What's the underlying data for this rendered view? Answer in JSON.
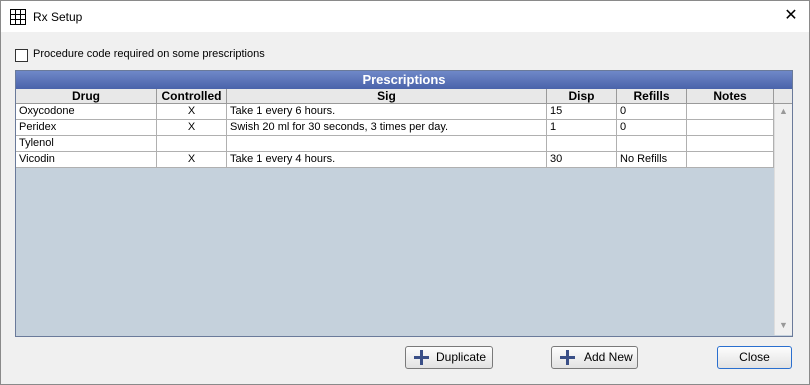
{
  "window": {
    "title": "Rx Setup",
    "close_glyph": "✕"
  },
  "options": {
    "procedure_code_label": "Procedure code required on some prescriptions",
    "procedure_code_checked": false
  },
  "grid": {
    "title": "Prescriptions",
    "columns": [
      "Drug",
      "Controlled",
      "Sig",
      "Disp",
      "Refills",
      "Notes"
    ],
    "rows": [
      {
        "drug": "Oxycodone",
        "controlled": "X",
        "sig": "Take 1 every 6 hours.",
        "disp": "15",
        "refills": "0",
        "notes": ""
      },
      {
        "drug": "Peridex",
        "controlled": "X",
        "sig": "Swish 20 ml for 30 seconds, 3 times per day.",
        "disp": "1",
        "refills": "0",
        "notes": ""
      },
      {
        "drug": "Tylenol",
        "controlled": "",
        "sig": "",
        "disp": "",
        "refills": "",
        "notes": ""
      },
      {
        "drug": "Vicodin",
        "controlled": "X",
        "sig": "Take 1 every 4 hours.",
        "disp": "30",
        "refills": "No Refills",
        "notes": ""
      }
    ]
  },
  "buttons": {
    "duplicate": "Duplicate",
    "add_new": "Add New",
    "close": "Close"
  },
  "colors": {
    "grid_title_bg": "#5b74ba",
    "grid_bg": "#c5d1dc",
    "plus_icon": "#3a4f87"
  }
}
